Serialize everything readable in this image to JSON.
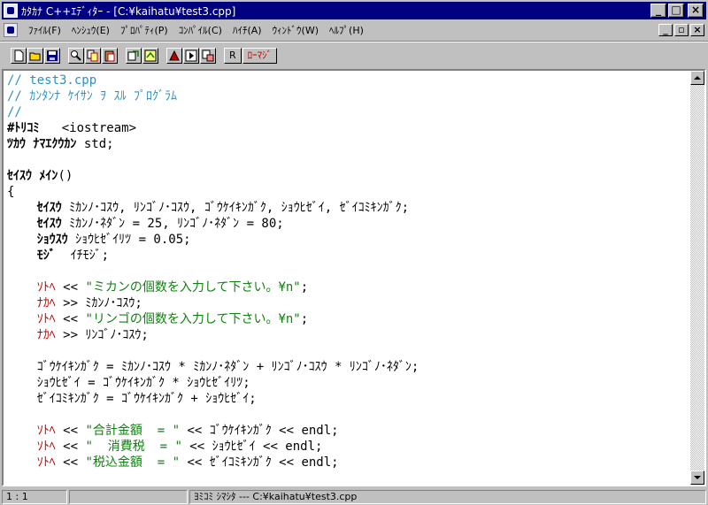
{
  "window": {
    "title": "ｶﾀｶﾅ C++ｴﾃﾞｨﾀｰ - [C:¥kaihatu¥test3.cpp]",
    "minimize": "_",
    "maximize": "□",
    "close": "×"
  },
  "menu": {
    "items": [
      {
        "label": "ﾌｧｲﾙ(F)"
      },
      {
        "label": "ﾍﾝｼｭｳ(E)"
      },
      {
        "label": "ﾌﾟﾛﾊﾟﾃｨ(P)"
      },
      {
        "label": "ｺﾝﾊﾟｲﾙ(C)"
      },
      {
        "label": "ﾊｲﾁ(A)"
      },
      {
        "label": "ｳｨﾝﾄﾞｳ(W)"
      },
      {
        "label": "ﾍﾙﾌﾟ(H)"
      }
    ],
    "mdi_minimize": "_",
    "mdi_restore": "▫",
    "mdi_close": "×"
  },
  "toolbar": {
    "r_button": "R",
    "romaji_button": "ﾛｰﾏｼﾞ"
  },
  "code": {
    "lines": [
      [
        {
          "t": "// test3.cpp",
          "c": "c-comment"
        }
      ],
      [
        {
          "t": "// ｶﾝﾀﾝﾅ ｹｲｻﾝ ｦ ｽﾙ ﾌﾟﾛｸﾞﾗﾑ",
          "c": "c-comment"
        }
      ],
      [
        {
          "t": "//",
          "c": "c-comment"
        }
      ],
      [
        {
          "t": "#ﾄﾘｺﾐ",
          "c": "c-kw"
        },
        {
          "t": "   <iostream>",
          "c": "c-text"
        }
      ],
      [
        {
          "t": "ﾂｶｳ ﾅﾏｴｸｳｶﾝ",
          "c": "c-kw"
        },
        {
          "t": " std;",
          "c": "c-text"
        }
      ],
      [
        {
          "t": "",
          "c": "c-text"
        }
      ],
      [
        {
          "t": "ｾｲｽｳ ﾒｲﾝ",
          "c": "c-kw"
        },
        {
          "t": "()",
          "c": "c-text"
        }
      ],
      [
        {
          "t": "{",
          "c": "c-text"
        }
      ],
      [
        {
          "t": "    ",
          "c": "c-text"
        },
        {
          "t": "ｾｲｽｳ",
          "c": "c-kw"
        },
        {
          "t": " ﾐｶﾝﾉ･ｺｽｳ, ﾘﾝｺﾞﾉ･ｺｽｳ, ｺﾞｳｹｲｷﾝｶﾞｸ, ｼｮｳﾋｾﾞｲ, ｾﾞｲｺﾐｷﾝｶﾞｸ;",
          "c": "c-text"
        }
      ],
      [
        {
          "t": "    ",
          "c": "c-text"
        },
        {
          "t": "ｾｲｽｳ",
          "c": "c-kw"
        },
        {
          "t": " ﾐｶﾝﾉ･ﾈﾀﾞﾝ = 25, ﾘﾝｺﾞﾉ･ﾈﾀﾞﾝ = 80;",
          "c": "c-text"
        }
      ],
      [
        {
          "t": "    ",
          "c": "c-text"
        },
        {
          "t": "ｼｮｳｽｳ",
          "c": "c-kw"
        },
        {
          "t": " ｼｮｳﾋｾﾞｲﾘﾂ = 0.05;",
          "c": "c-text"
        }
      ],
      [
        {
          "t": "    ",
          "c": "c-text"
        },
        {
          "t": "ﾓｼﾞ",
          "c": "c-kw"
        },
        {
          "t": "  ｲﾁﾓｼﾞ;",
          "c": "c-text"
        }
      ],
      [
        {
          "t": "",
          "c": "c-text"
        }
      ],
      [
        {
          "t": "    ",
          "c": "c-text"
        },
        {
          "t": "ｿﾄﾍ",
          "c": "c-red"
        },
        {
          "t": " << ",
          "c": "c-text"
        },
        {
          "t": "\"ミカンの個数を入力して下さい。¥n\"",
          "c": "c-str"
        },
        {
          "t": ";",
          "c": "c-text"
        }
      ],
      [
        {
          "t": "    ",
          "c": "c-text"
        },
        {
          "t": "ﾅｶﾍ",
          "c": "c-red"
        },
        {
          "t": " >> ﾐｶﾝﾉ･ｺｽｳ;",
          "c": "c-text"
        }
      ],
      [
        {
          "t": "    ",
          "c": "c-text"
        },
        {
          "t": "ｿﾄﾍ",
          "c": "c-red"
        },
        {
          "t": " << ",
          "c": "c-text"
        },
        {
          "t": "\"リンゴの個数を入力して下さい。¥n\"",
          "c": "c-str"
        },
        {
          "t": ";",
          "c": "c-text"
        }
      ],
      [
        {
          "t": "    ",
          "c": "c-text"
        },
        {
          "t": "ﾅｶﾍ",
          "c": "c-red"
        },
        {
          "t": " >> ﾘﾝｺﾞﾉ･ｺｽｳ;",
          "c": "c-text"
        }
      ],
      [
        {
          "t": "",
          "c": "c-text"
        }
      ],
      [
        {
          "t": "    ｺﾞｳｹｲｷﾝｶﾞｸ = ﾐｶﾝﾉ･ｺｽｳ * ﾐｶﾝﾉ･ﾈﾀﾞﾝ + ﾘﾝｺﾞﾉ･ｺｽｳ * ﾘﾝｺﾞﾉ･ﾈﾀﾞﾝ;",
          "c": "c-text"
        }
      ],
      [
        {
          "t": "    ｼｮｳﾋｾﾞｲ = ｺﾞｳｹｲｷﾝｶﾞｸ * ｼｮｳﾋｾﾞｲﾘﾂ;",
          "c": "c-text"
        }
      ],
      [
        {
          "t": "    ｾﾞｲｺﾐｷﾝｶﾞｸ = ｺﾞｳｹｲｷﾝｶﾞｸ + ｼｮｳﾋｾﾞｲ;",
          "c": "c-text"
        }
      ],
      [
        {
          "t": "",
          "c": "c-text"
        }
      ],
      [
        {
          "t": "    ",
          "c": "c-text"
        },
        {
          "t": "ｿﾄﾍ",
          "c": "c-red"
        },
        {
          "t": " << ",
          "c": "c-text"
        },
        {
          "t": "\"合計金額  = \"",
          "c": "c-str"
        },
        {
          "t": " << ｺﾞｳｹｲｷﾝｶﾞｸ << endl;",
          "c": "c-text"
        }
      ],
      [
        {
          "t": "    ",
          "c": "c-text"
        },
        {
          "t": "ｿﾄﾍ",
          "c": "c-red"
        },
        {
          "t": " << ",
          "c": "c-text"
        },
        {
          "t": "\"  消費税  = \"",
          "c": "c-str"
        },
        {
          "t": " << ｼｮｳﾋｾﾞｲ << endl;",
          "c": "c-text"
        }
      ],
      [
        {
          "t": "    ",
          "c": "c-text"
        },
        {
          "t": "ｿﾄﾍ",
          "c": "c-red"
        },
        {
          "t": " << ",
          "c": "c-text"
        },
        {
          "t": "\"税込金額  = \"",
          "c": "c-str"
        },
        {
          "t": " << ｾﾞｲｺﾐｷﾝｶﾞｸ << endl;",
          "c": "c-text"
        }
      ]
    ]
  },
  "status": {
    "position": " 1 :   1",
    "mode": "",
    "message": "ﾖﾐｺﾐ ｼﾏｼﾀ --- C:¥kaihatu¥test3.cpp"
  }
}
